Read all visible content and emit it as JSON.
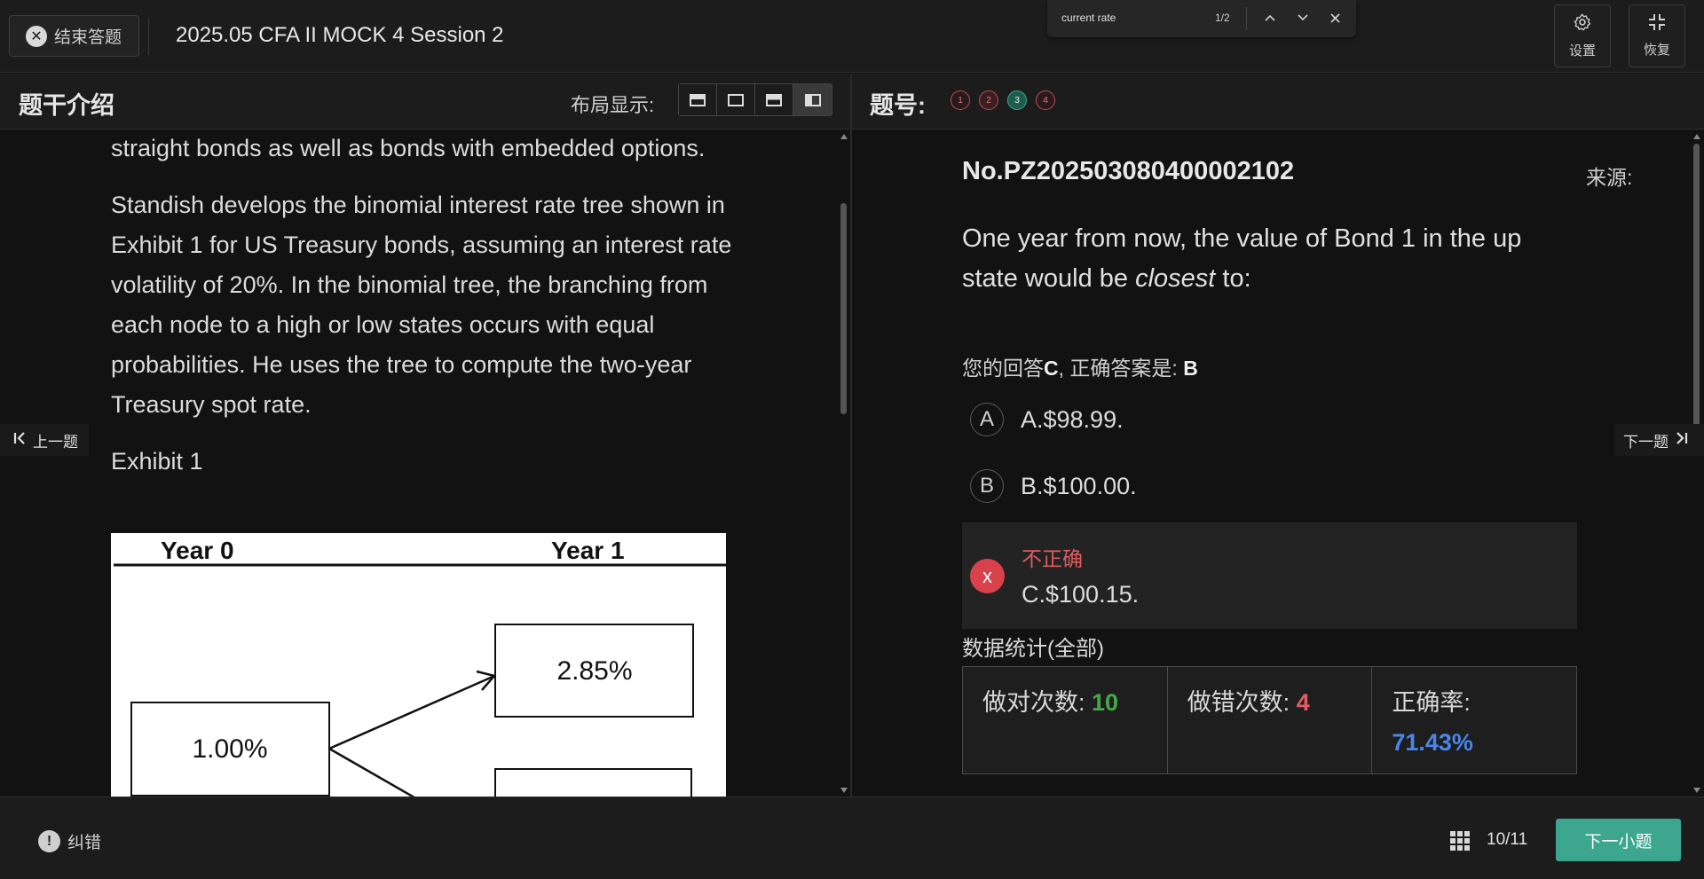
{
  "topbar": {
    "exit_label": "结束答题",
    "title": "2025.05 CFA II MOCK 4 Session 2",
    "settings_label": "设置",
    "restore_label": "恢复"
  },
  "findbar": {
    "query": "current rate",
    "count": "1/2"
  },
  "left_panel": {
    "title": "题干介绍",
    "layout_label": "布局显示:",
    "passage": [
      "straight bonds as well as bonds with embedded options.",
      "Standish develops the binomial interest rate tree shown in Exhibit 1 for US Treasury bonds, assuming an interest rate volatility of 20%. In the binomial tree, the branching from each node to a high or low states occurs with equal probabilities. He uses the tree to compute the two-year Treasury spot rate."
    ],
    "exhibit_label": "Exhibit 1",
    "exhibit": {
      "year0": "Year 0",
      "year1": "Year 1",
      "node_root": "1.00%",
      "node_up": "2.85%"
    }
  },
  "right_panel": {
    "title": "题号:",
    "question_numbers": [
      "1",
      "2",
      "3",
      "4"
    ],
    "question_id": "No.PZ202503080400002102",
    "source_label": "来源:",
    "stem_part1": "One year from now, the value of Bond 1 in the up state would be ",
    "stem_emph": "closest",
    "stem_part2": " to:",
    "answer_prefix": "您的回答",
    "answer_user": "C",
    "answer_middle": ", 正确答案是: ",
    "answer_correct": "B",
    "options": [
      {
        "letter": "A",
        "text": "A.$98.99."
      },
      {
        "letter": "B",
        "text": "B.$100.00."
      },
      {
        "letter": "x",
        "text": "C.$100.15.",
        "status": "不正确"
      }
    ],
    "stats_title": "数据统计(全部)",
    "stats": {
      "correct_label": "做对次数: ",
      "correct_value": "10",
      "wrong_label": "做错次数: ",
      "wrong_value": "4",
      "rate_label": "正确率:",
      "rate_value": "71.43%"
    }
  },
  "nav": {
    "prev_label": "上一题",
    "next_label": "下一题"
  },
  "footer": {
    "report_label": "纠错",
    "progress": "10/11",
    "next_sub_label": "下一小题"
  },
  "colors": {
    "accent_teal": "#3ca68f",
    "correct_green": "#46a84a",
    "wrong_red": "#e25b62",
    "rate_blue": "#4a86e8"
  }
}
